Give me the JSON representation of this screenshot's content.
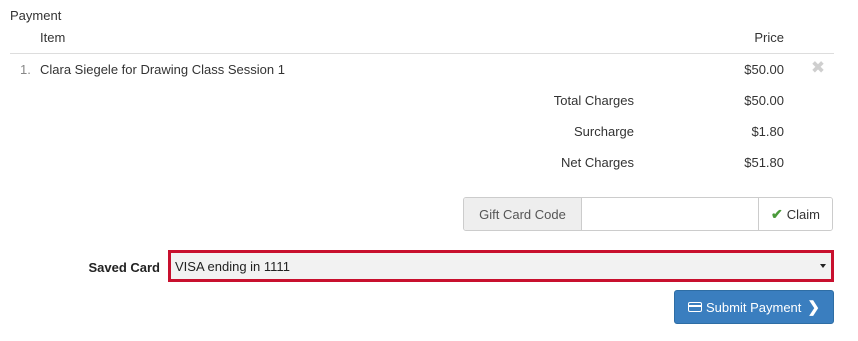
{
  "section_title": "Payment",
  "table": {
    "headers": {
      "item": "Item",
      "price": "Price"
    },
    "rows": [
      {
        "num": "1.",
        "description": "Clara Siegele for Drawing Class Session 1",
        "price": "$50.00",
        "remove_icon": "close-icon"
      }
    ]
  },
  "summary": {
    "total_label": "Total Charges",
    "total_value": "$50.00",
    "surcharge_label": "Surcharge",
    "surcharge_value": "$1.80",
    "net_label": "Net Charges",
    "net_value": "$51.80"
  },
  "gift_card": {
    "addon_label": "Gift Card Code",
    "input_value": "",
    "input_placeholder": "",
    "claim_label": "Claim",
    "claim_icon": "check-icon"
  },
  "saved_card": {
    "label": "Saved Card",
    "selected_value": "VISA ending in 1111",
    "highlight_color": "#c8102e"
  },
  "submit": {
    "label": "Submit Payment",
    "icon": "credit-card-icon",
    "trailing_icon": "chevron-right-icon",
    "color": "#3a7ebf"
  }
}
